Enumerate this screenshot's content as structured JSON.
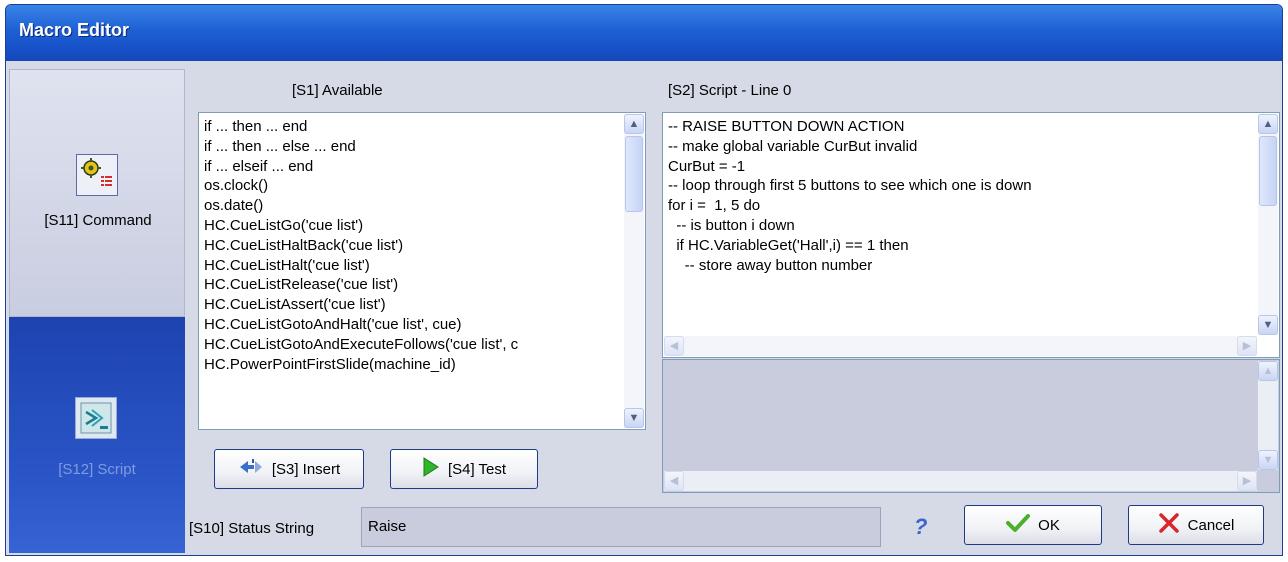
{
  "window": {
    "title": "Macro Editor"
  },
  "nav": {
    "command": {
      "label": "[S11] Command",
      "icon": "command-gear-icon"
    },
    "script": {
      "label": "[S12] Script",
      "icon": "script-icon"
    }
  },
  "available": {
    "label": "[S1] Available",
    "items": [
      "if ... then ... end",
      "if ... then ... else ... end",
      "if ... elseif ... end",
      "os.clock()",
      "os.date()",
      "HC.CueListGo('cue list')",
      "HC.CueListHaltBack('cue list')",
      "HC.CueListHalt('cue list')",
      "HC.CueListRelease('cue list')",
      "HC.CueListAssert('cue list')",
      "HC.CueListGotoAndHalt('cue list', cue)",
      "HC.CueListGotoAndExecuteFollows('cue list', c",
      "HC.PowerPointFirstSlide(machine_id)"
    ]
  },
  "script": {
    "label": "[S2] Script - Line 0",
    "lines": [
      "-- RAISE BUTTON DOWN ACTION",
      "-- make global variable CurBut invalid",
      "CurBut = -1",
      "-- loop through first 5 buttons to see which one is down",
      "for i =  1, 5 do",
      "  -- is button i down",
      "  if HC.VariableGet('Hall',i) == 1 then",
      "    -- store away button number"
    ]
  },
  "buttons": {
    "insert": "[S3] Insert",
    "test": "[S4] Test",
    "ok": "OK",
    "cancel": "Cancel",
    "help": "?"
  },
  "status": {
    "label": "[S10] Status String",
    "value": "Raise"
  },
  "colors": {
    "title_bar": "#1e60d4",
    "nav_selected": "#2b56c8",
    "ok_check": "#4caf2a",
    "cancel_x": "#d8262b",
    "test_play": "#2fb52a"
  }
}
